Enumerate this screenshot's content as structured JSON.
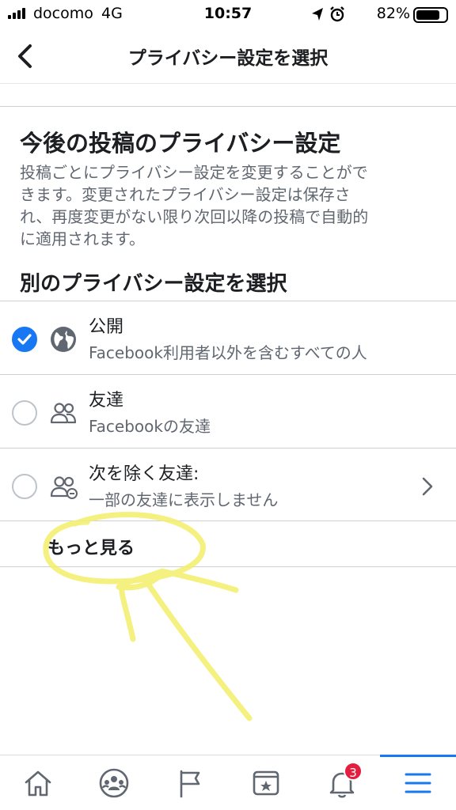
{
  "status_bar": {
    "carrier": "docomo",
    "network": "4G",
    "time": "10:57",
    "battery": "82%"
  },
  "header": {
    "title": "プライバシー設定を選択"
  },
  "section": {
    "title": "今後の投稿のプライバシー設定",
    "description_lines": [
      "投稿ごとにプライバシー設定を変更することがで",
      "きます。変更されたプライバシー設定は保存さ",
      "れ、再度変更がない限り次回以降の投稿で自動的",
      "に適用されます。"
    ]
  },
  "choose": {
    "title": "別のプライバシー設定を選択"
  },
  "options": [
    {
      "label": "公開",
      "sub": "Facebook利用者以外を含むすべての人",
      "icon": "globe-icon",
      "selected": true
    },
    {
      "label": "友達",
      "sub": "Facebookの友達",
      "icon": "friends-icon",
      "selected": false
    },
    {
      "label": "次を除く友達:",
      "sub": "一部の友達に表示しません",
      "icon": "friends-except-icon",
      "selected": false
    }
  ],
  "see_more": {
    "label": "もっと見る"
  },
  "tabs": [
    {
      "icon": "home-icon"
    },
    {
      "icon": "groups-icon"
    },
    {
      "icon": "pages-flag-icon"
    },
    {
      "icon": "bookmark-icon"
    },
    {
      "icon": "notifications-bell-icon",
      "badge": "3"
    },
    {
      "icon": "menu-icon",
      "active": true
    }
  ],
  "colors": {
    "accent": "#1877f2",
    "badge": "#e41e3f",
    "annotation": "#f3ef6a"
  }
}
